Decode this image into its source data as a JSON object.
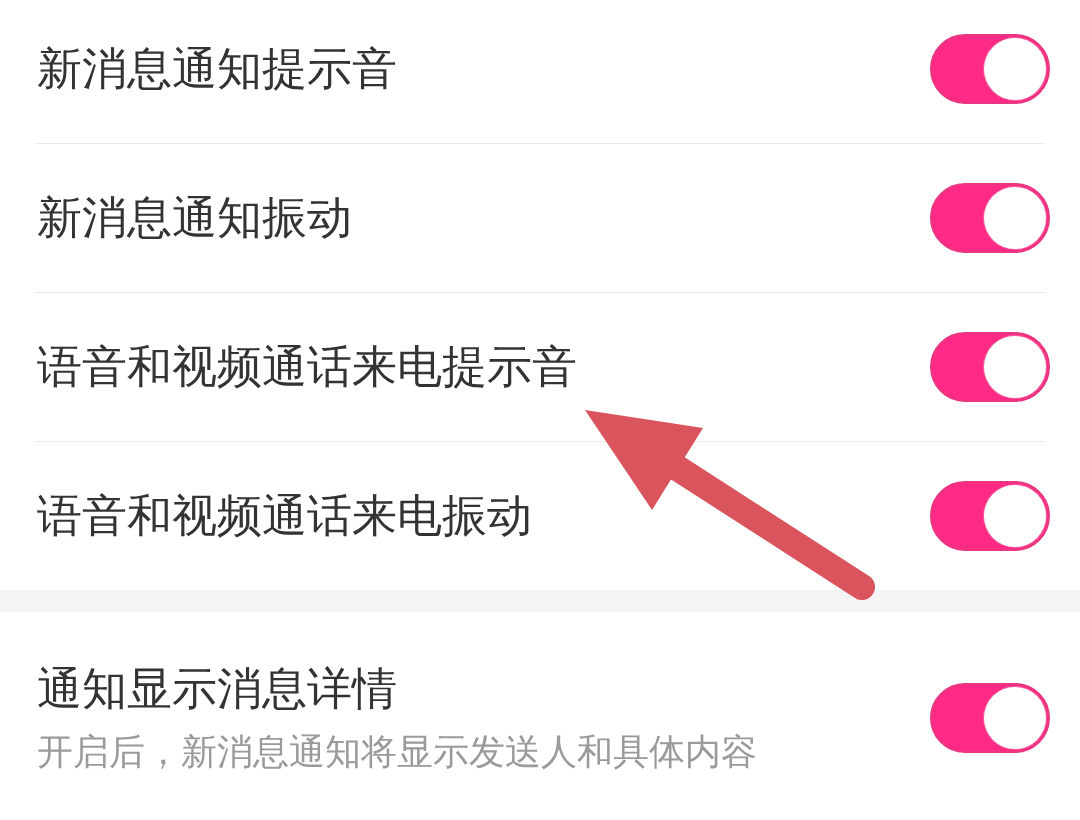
{
  "settings_groups": [
    {
      "items": [
        {
          "label": "新消息通知提示音",
          "on": true
        },
        {
          "label": "新消息通知振动",
          "on": true
        },
        {
          "label": "语音和视频通话来电提示音",
          "on": true
        },
        {
          "label": "语音和视频通话来电振动",
          "on": true
        }
      ]
    },
    {
      "items": [
        {
          "label": "通知显示消息详情",
          "description": "开启后，新消息通知将显示发送人和具体内容",
          "on": true
        }
      ]
    }
  ]
}
